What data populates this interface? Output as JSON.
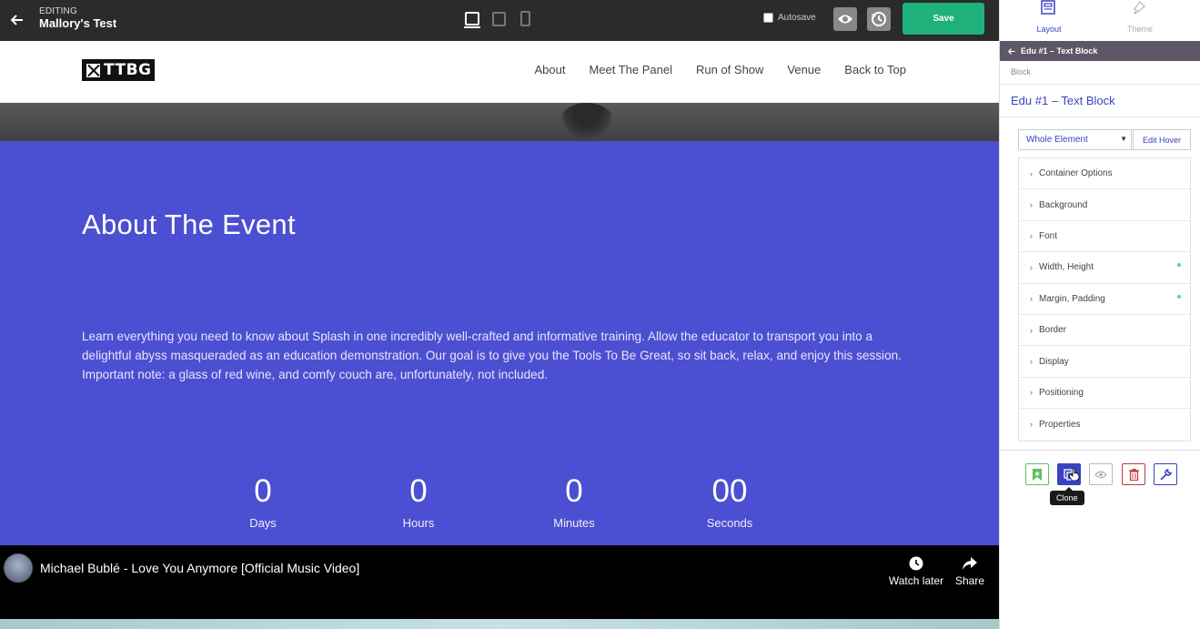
{
  "editor": {
    "label": "EDITING",
    "title": "Mallory's Test",
    "autosave_label": "Autosave",
    "save_label": "Save"
  },
  "site": {
    "logo_text": "TTBG",
    "nav": [
      "About",
      "Meet The Panel",
      "Run of Show",
      "Venue",
      "Back to Top"
    ]
  },
  "about": {
    "title": "About The Event",
    "body": "Learn everything you need to know about Splash in one incredibly well-crafted and informative training. Allow the educator to transport you into a delightful abyss masqueraded as an education demonstration. Our goal is to give you the Tools To Be Great, so sit back, relax, and enjoy this session. Important note: a glass of red wine, and comfy couch are, unfortunately, not included.",
    "countdown": [
      {
        "value": "0",
        "label": "Days"
      },
      {
        "value": "0",
        "label": "Hours"
      },
      {
        "value": "0",
        "label": "Minutes"
      },
      {
        "value": "00",
        "label": "Seconds"
      }
    ],
    "background_color": "#4b4fd1"
  },
  "video": {
    "title": "Michael Bublé - Love You Anymore [Official Music Video]",
    "watch_later": "Watch later",
    "share": "Share"
  },
  "panel": {
    "tabs": [
      "Layout",
      "Theme"
    ],
    "breadcrumb": "Edu #1 – Text Block",
    "type": "Block",
    "heading": "Edu #1 – Text Block",
    "element_select": "Whole Element",
    "edit_hover": "Edit Hover",
    "sections": [
      {
        "label": "Container Options",
        "modified": false
      },
      {
        "label": "Background",
        "modified": false
      },
      {
        "label": "Font",
        "modified": false
      },
      {
        "label": "Width, Height",
        "modified": true
      },
      {
        "label": "Margin, Padding",
        "modified": true
      },
      {
        "label": "Border",
        "modified": false
      },
      {
        "label": "Display",
        "modified": false
      },
      {
        "label": "Positioning",
        "modified": false
      },
      {
        "label": "Properties",
        "modified": false
      }
    ],
    "tooltip": "Clone",
    "accent_color": "#3a42c0"
  }
}
